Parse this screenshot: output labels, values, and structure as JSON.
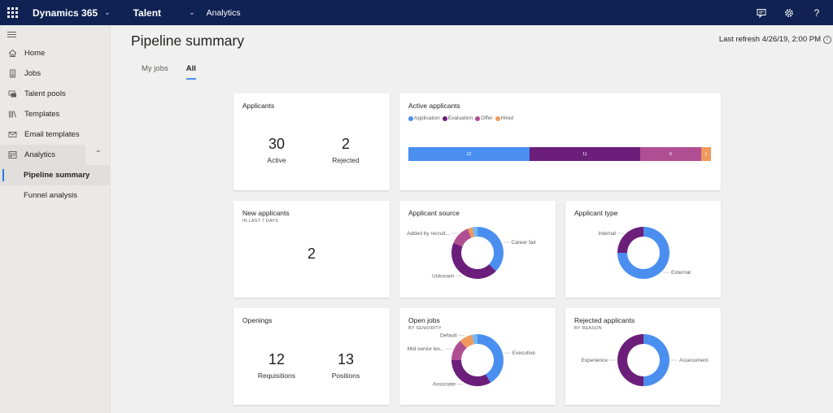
{
  "topbar": {
    "app_name": "Dynamics 365",
    "module": "Talent",
    "breadcrumb": "Analytics",
    "icons": [
      "feedback-icon",
      "settings-icon",
      "help-icon"
    ],
    "help_glyph": "?"
  },
  "sidebar": {
    "items": [
      {
        "label": "Home",
        "icon": "home-icon"
      },
      {
        "label": "Jobs",
        "icon": "jobs-icon"
      },
      {
        "label": "Talent pools",
        "icon": "talent-pools-icon"
      },
      {
        "label": "Templates",
        "icon": "templates-icon"
      },
      {
        "label": "Email templates",
        "icon": "email-icon"
      }
    ],
    "group": {
      "label": "Analytics",
      "icon": "analytics-icon",
      "expanded": true
    },
    "sub_items": [
      {
        "label": "Pipeline summary",
        "active": true
      },
      {
        "label": "Funnel analysis",
        "active": false
      }
    ]
  },
  "page": {
    "title": "Pipeline summary",
    "last_refresh": "Last refresh 4/26/19, 2:00 PM",
    "info_glyph": "i",
    "tabs": [
      {
        "label": "My jobs",
        "active": false
      },
      {
        "label": "All",
        "active": true
      }
    ]
  },
  "colors": {
    "blue": "#4a8ff0",
    "purple": "#6b1e7a",
    "magenta": "#b04e92",
    "orange": "#ee9a5e",
    "light_blue": "#74b6f2",
    "accent": "#2b7ae0",
    "topbar": "#102253"
  },
  "cards": {
    "applicants": {
      "title": "Applicants",
      "kpis": [
        {
          "value": "30",
          "label": "Active"
        },
        {
          "value": "2",
          "label": "Rejected"
        }
      ]
    },
    "new_applicants": {
      "title": "New applicants",
      "subtitle": "IN LAST 7 DAYS",
      "value": "2"
    },
    "openings": {
      "title": "Openings",
      "kpis": [
        {
          "value": "12",
          "label": "Requisitions"
        },
        {
          "value": "13",
          "label": "Positions"
        }
      ]
    }
  },
  "chart_data": [
    {
      "id": "active_applicants",
      "type": "bar",
      "orientation": "horizontal-stacked",
      "title": "Active applicants",
      "legend": "top-left",
      "series": [
        {
          "name": "Application",
          "value": 12,
          "color": "#4a8ff0"
        },
        {
          "name": "Evaluation",
          "value": 11,
          "color": "#6b1e7a"
        },
        {
          "name": "Offer",
          "value": 6,
          "color": "#b04e92"
        },
        {
          "name": "Hired",
          "value": 1,
          "color": "#ee9a5e"
        }
      ]
    },
    {
      "id": "applicant_source",
      "type": "pie",
      "donut": true,
      "title": "Applicant source",
      "slices": [
        {
          "name": "Career fair",
          "value": 12,
          "color": "#4a8ff0",
          "labeled": true
        },
        {
          "name": "Unknown",
          "value": 14,
          "color": "#6b1e7a",
          "labeled": true
        },
        {
          "name": "Added by recruit...",
          "value": 4,
          "color": "#b04e92",
          "labeled": true
        },
        {
          "name": "",
          "value": 1,
          "color": "#ee9a5e",
          "labeled": false
        },
        {
          "name": "",
          "value": 1,
          "color": "#74b6f2",
          "labeled": false
        }
      ]
    },
    {
      "id": "applicant_type",
      "type": "pie",
      "donut": true,
      "title": "Applicant type",
      "slices": [
        {
          "name": "External",
          "value": 24,
          "color": "#4a8ff0",
          "labeled": true
        },
        {
          "name": "Internal",
          "value": 8,
          "color": "#6b1e7a",
          "labeled": true
        }
      ]
    },
    {
      "id": "open_jobs",
      "type": "pie",
      "donut": true,
      "title": "Open jobs",
      "subtitle": "BY SENIORITY",
      "slices": [
        {
          "name": "Executive",
          "value": 5,
          "color": "#4a8ff0",
          "labeled": true
        },
        {
          "name": "Associate",
          "value": 4,
          "color": "#6b1e7a",
          "labeled": true
        },
        {
          "name": "Mid senior lev...",
          "value": 1.6,
          "color": "#b04e92",
          "labeled": true
        },
        {
          "name": "Default",
          "value": 1,
          "color": "#ee9a5e",
          "labeled": true
        },
        {
          "name": "",
          "value": 0.4,
          "color": "#74b6f2",
          "labeled": false
        }
      ]
    },
    {
      "id": "rejected_applicants",
      "type": "pie",
      "donut": true,
      "title": "Rejected applicants",
      "subtitle": "BY REASON",
      "slices": [
        {
          "name": "Assessment",
          "value": 1,
          "color": "#4a8ff0",
          "labeled": true
        },
        {
          "name": "Experience",
          "value": 1,
          "color": "#6b1e7a",
          "labeled": true
        }
      ]
    }
  ]
}
